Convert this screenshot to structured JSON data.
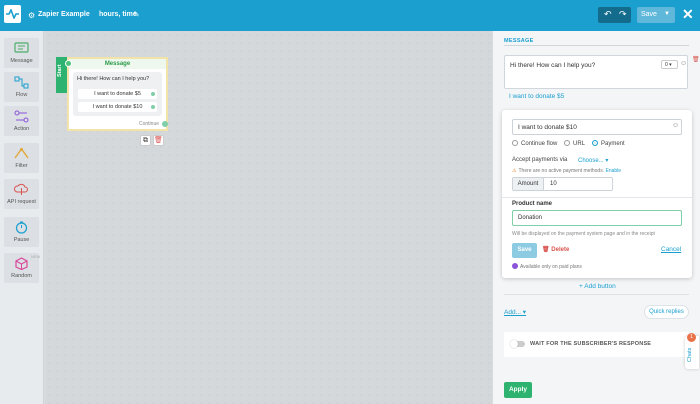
{
  "header": {
    "flow_name": "Zapier Example",
    "step_name": "hours, time",
    "save_label": "Save",
    "undo_icon": "↶",
    "redo_icon": "↷",
    "close_icon": "✕"
  },
  "toolbar": [
    {
      "label": "Message"
    },
    {
      "label": "Flow"
    },
    {
      "label": "Action"
    },
    {
      "label": "Filter"
    },
    {
      "label": "API request"
    },
    {
      "label": "Pause"
    },
    {
      "label": "Random",
      "badge": "NEW"
    }
  ],
  "node": {
    "start_label": "Start",
    "title": "Message",
    "text": "Hi there! How can I help you?",
    "buttons": [
      "I want to donate $5",
      "I want to donate $10"
    ],
    "continue_label": "Continue"
  },
  "panel": {
    "section_title": "MESSAGE",
    "message_text": "Hi there! How can I help you?",
    "char_count": "0",
    "existing_button": "I want to donate $5",
    "editor": {
      "button_text": "I want to donate $10",
      "radio_options": [
        "Continue flow",
        "URL",
        "Payment"
      ],
      "selected_option": "Payment",
      "accept_label": "Accept payments via",
      "choose_label": "Choose...",
      "warning_text": "There are no active payment methods.",
      "enable_link": "Enable",
      "amount_label": "Amount",
      "amount_value": "10",
      "product_name_label": "Product name",
      "product_name_value": "Donation",
      "product_help": "Will be displayed on the payment system page and in the receipt",
      "save_label": "Save",
      "delete_label": "Delete",
      "cancel_label": "Cancel",
      "paid_note": "Available only on paid plans"
    },
    "add_button_label": "+ Add button",
    "add_menu_label": "Add...",
    "quick_replies_label": "Quick replies",
    "wait_label": "WAIT FOR THE SUBSCRIBER'S RESPONSE",
    "chats_label": "Chats",
    "chats_badge": "1",
    "apply_label": "Apply"
  }
}
